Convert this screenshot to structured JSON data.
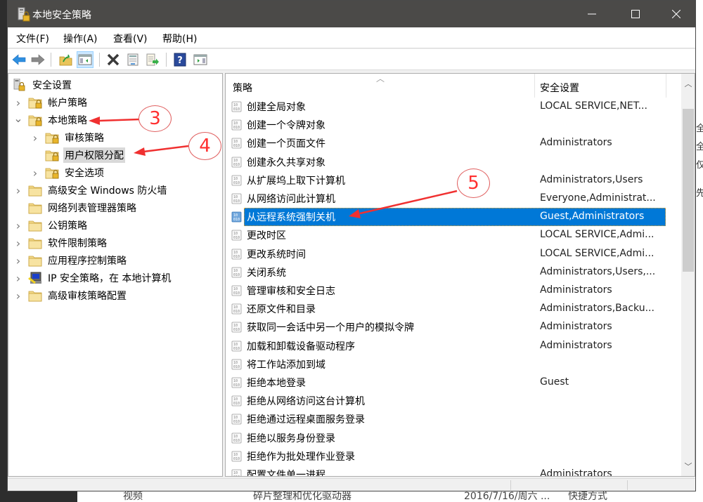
{
  "window": {
    "title": "本地安全策略",
    "controls": {
      "minimize": "minimize",
      "maximize": "maximize",
      "close": "close"
    }
  },
  "menubar": {
    "items": [
      {
        "label": "文件(F)"
      },
      {
        "label": "操作(A)"
      },
      {
        "label": "查看(V)"
      },
      {
        "label": "帮助(H)"
      }
    ]
  },
  "toolbar": {
    "buttons": [
      {
        "icon": "back-arrow-icon",
        "name": "back"
      },
      {
        "icon": "forward-arrow-icon",
        "name": "forward"
      },
      {
        "icon": "up-folder-icon",
        "name": "up-one-level"
      },
      {
        "icon": "show-hide-console-tree-icon",
        "name": "show-hide-tree",
        "active": true
      },
      {
        "icon": "delete-icon",
        "name": "delete"
      },
      {
        "icon": "properties-icon",
        "name": "properties"
      },
      {
        "icon": "export-list-icon",
        "name": "export-list"
      },
      {
        "icon": "help-icon",
        "name": "help"
      },
      {
        "icon": "show-hide-action-pane-icon",
        "name": "show-hide-action-pane"
      }
    ]
  },
  "tree": {
    "root": "安全设置",
    "items": [
      {
        "label": "帐户策略",
        "level": 1,
        "expander": "collapsed",
        "icon": "locked-folder"
      },
      {
        "label": "本地策略",
        "level": 1,
        "expander": "expanded",
        "icon": "locked-folder"
      },
      {
        "label": "审核策略",
        "level": 2,
        "expander": "collapsed",
        "icon": "locked-folder"
      },
      {
        "label": "用户权限分配",
        "level": 2,
        "expander": "none",
        "icon": "locked-folder",
        "selected": true
      },
      {
        "label": "安全选项",
        "level": 2,
        "expander": "collapsed",
        "icon": "locked-folder"
      },
      {
        "label": "高级安全 Windows 防火墙",
        "level": 1,
        "expander": "collapsed",
        "icon": "folder"
      },
      {
        "label": "网络列表管理器策略",
        "level": 1,
        "expander": "none",
        "icon": "folder"
      },
      {
        "label": "公钥策略",
        "level": 1,
        "expander": "collapsed",
        "icon": "folder"
      },
      {
        "label": "软件限制策略",
        "level": 1,
        "expander": "collapsed",
        "icon": "folder"
      },
      {
        "label": "应用程序控制策略",
        "level": 1,
        "expander": "collapsed",
        "icon": "folder"
      },
      {
        "label": "IP 安全策略，在 本地计算机",
        "level": 1,
        "expander": "collapsed",
        "icon": "ip-security"
      },
      {
        "label": "高级审核策略配置",
        "level": 1,
        "expander": "collapsed",
        "icon": "folder"
      }
    ]
  },
  "list": {
    "columns": {
      "policy": "策略",
      "setting": "安全设置"
    },
    "rows": [
      {
        "policy": "创建全局对象",
        "setting": "LOCAL SERVICE,NET..."
      },
      {
        "policy": "创建一个令牌对象",
        "setting": ""
      },
      {
        "policy": "创建一个页面文件",
        "setting": "Administrators"
      },
      {
        "policy": "创建永久共享对象",
        "setting": ""
      },
      {
        "policy": "从扩展坞上取下计算机",
        "setting": "Administrators,Users"
      },
      {
        "policy": "从网络访问此计算机",
        "setting": "Everyone,Administrat..."
      },
      {
        "policy": "从远程系统强制关机",
        "setting": "Guest,Administrators",
        "selected": true
      },
      {
        "policy": "更改时区",
        "setting": "LOCAL SERVICE,Admi..."
      },
      {
        "policy": "更改系统时间",
        "setting": "LOCAL SERVICE,Admi..."
      },
      {
        "policy": "关闭系统",
        "setting": "Administrators,Users,..."
      },
      {
        "policy": "管理审核和安全日志",
        "setting": "Administrators"
      },
      {
        "policy": "还原文件和目录",
        "setting": "Administrators,Backu..."
      },
      {
        "policy": "获取同一会话中另一个用户的模拟令牌",
        "setting": "Administrators"
      },
      {
        "policy": "加载和卸载设备驱动程序",
        "setting": "Administrators"
      },
      {
        "policy": "将工作站添加到域",
        "setting": ""
      },
      {
        "policy": "拒绝本地登录",
        "setting": "Guest"
      },
      {
        "policy": "拒绝从网络访问这台计算机",
        "setting": ""
      },
      {
        "policy": "拒绝通过远程桌面服务登录",
        "setting": ""
      },
      {
        "policy": "拒绝以服务身份登录",
        "setting": ""
      },
      {
        "policy": "拒绝作为批处理作业登录",
        "setting": ""
      },
      {
        "policy": "配置文件单一进程",
        "setting": "Administrators"
      }
    ]
  },
  "annotations": [
    {
      "number": "3",
      "target": "本地策略"
    },
    {
      "number": "4",
      "target": "用户权限分配"
    },
    {
      "number": "5",
      "target": "从远程系统强制关机"
    }
  ],
  "background": {
    "bottom_texts": [
      "视频",
      "碎片整理和优化驱动器",
      "2016/7/16/周六 ...",
      "快捷方式"
    ],
    "right_texts": [
      "全部",
      "全部",
      "仅I",
      "先"
    ]
  },
  "colors": {
    "titlebar": "#4b4a48",
    "selection": "#0078d7",
    "annotation": "#ff3030"
  }
}
